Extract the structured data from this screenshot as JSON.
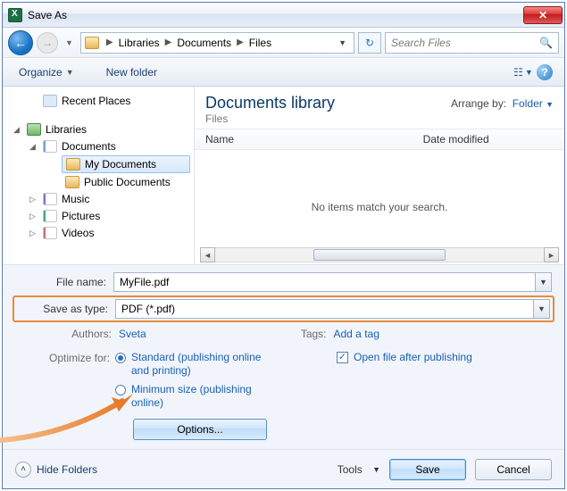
{
  "title": "Save As",
  "breadcrumb": {
    "c1": "Libraries",
    "c2": "Documents",
    "c3": "Files"
  },
  "search": {
    "placeholder": "Search Files"
  },
  "toolbar": {
    "organize": "Organize",
    "newfolder": "New folder"
  },
  "tree": {
    "recent": "Recent Places",
    "libraries": "Libraries",
    "documents": "Documents",
    "mydocs": "My Documents",
    "publicdocs": "Public Documents",
    "music": "Music",
    "pictures": "Pictures",
    "videos": "Videos"
  },
  "content": {
    "lib_title": "Documents library",
    "lib_sub": "Files",
    "arrange_label": "Arrange by:",
    "arrange_value": "Folder",
    "col_name": "Name",
    "col_date": "Date modified",
    "empty": "No items match your search."
  },
  "form": {
    "filename_label": "File name:",
    "filename_value": "MyFile.pdf",
    "savetype_label": "Save as type:",
    "savetype_value": "PDF (*.pdf)",
    "authors_label": "Authors:",
    "authors_value": "Sveta",
    "tags_label": "Tags:",
    "tags_value": "Add a tag",
    "optimize_label": "Optimize for:",
    "opt_radio1": "Standard (publishing online and printing)",
    "opt_radio2": "Minimum size (publishing online)",
    "open_after": "Open file after publishing",
    "options_btn": "Options..."
  },
  "footer": {
    "hide": "Hide Folders",
    "tools": "Tools",
    "save": "Save",
    "cancel": "Cancel"
  }
}
